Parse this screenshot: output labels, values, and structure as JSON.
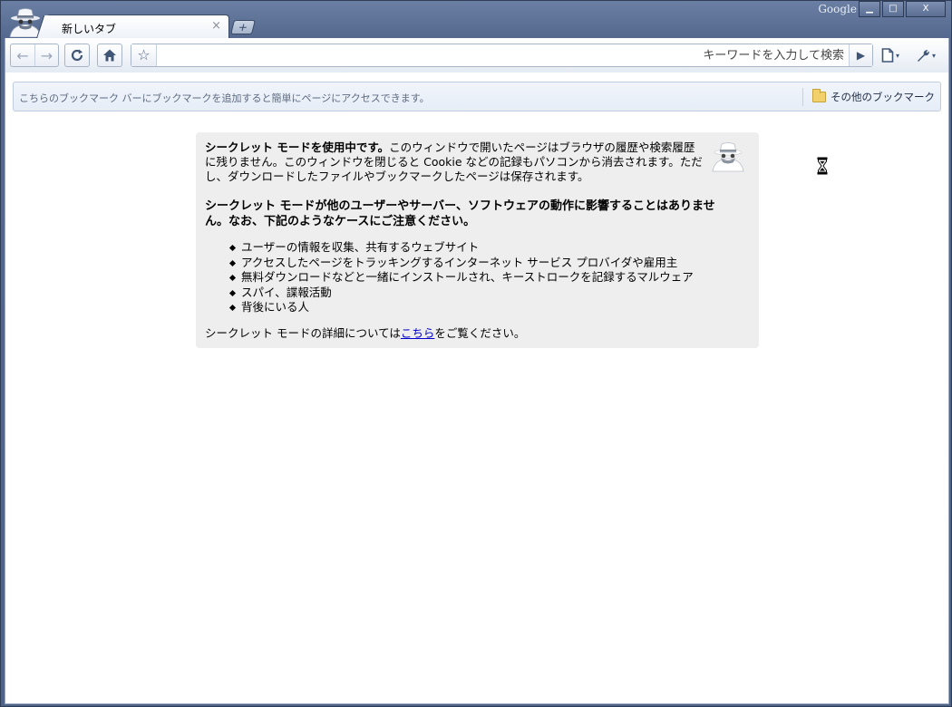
{
  "window": {
    "brand": "Google",
    "minimize_symbol": "▁",
    "maximize_symbol": "□",
    "close_symbol": "X"
  },
  "tab": {
    "title": "新しいタブ",
    "close_symbol": "×",
    "new_tab_symbol": "+"
  },
  "toolbar": {
    "back_symbol": "←",
    "forward_symbol": "→",
    "reload_symbol": "C",
    "home_symbol": "⌂",
    "star_symbol": "☆",
    "omnibox_placeholder": "キーワードを入力して検索",
    "omnibox_value": "",
    "go_symbol": "▶",
    "page_menu_symbol": "▯",
    "wrench_symbol": "🔧",
    "caret_symbol": "▾"
  },
  "bookmarks": {
    "hint": "こちらのブックマーク バーにブックマークを追加すると簡単にページにアクセスできます。",
    "other_label": "その他のブックマーク"
  },
  "incognito": {
    "para1_bold": "シークレット モードを使用中です。",
    "para1_rest": "このウィンドウで開いたページはブラウザの履歴や検索履歴に残りません。このウィンドウを閉じると Cookie などの記録もパソコンから消去されます。ただし、ダウンロードしたファイルやブックマークしたページは保存されます。",
    "para2": "シークレット モードが他のユーザーやサーバー、ソフトウェアの動作に影響することはありません。なお、下記のようなケースにご注意ください。",
    "risks": [
      "ユーザーの情報を収集、共有するウェブサイト",
      "アクセスしたページをトラッキングするインターネット サービス プロバイダや雇用主",
      "無料ダウンロードなどと一緒にインストールされ、キーストロークを記録するマルウェア",
      "スパイ、諜報活動",
      "背後にいる人"
    ],
    "more_prefix": "シークレット モードの詳細については",
    "more_link": "こちら",
    "more_suffix": "をご覧ください。"
  },
  "colors": {
    "frame": "#55698e",
    "box_background": "#eeeeee",
    "link": "#0000cc"
  }
}
